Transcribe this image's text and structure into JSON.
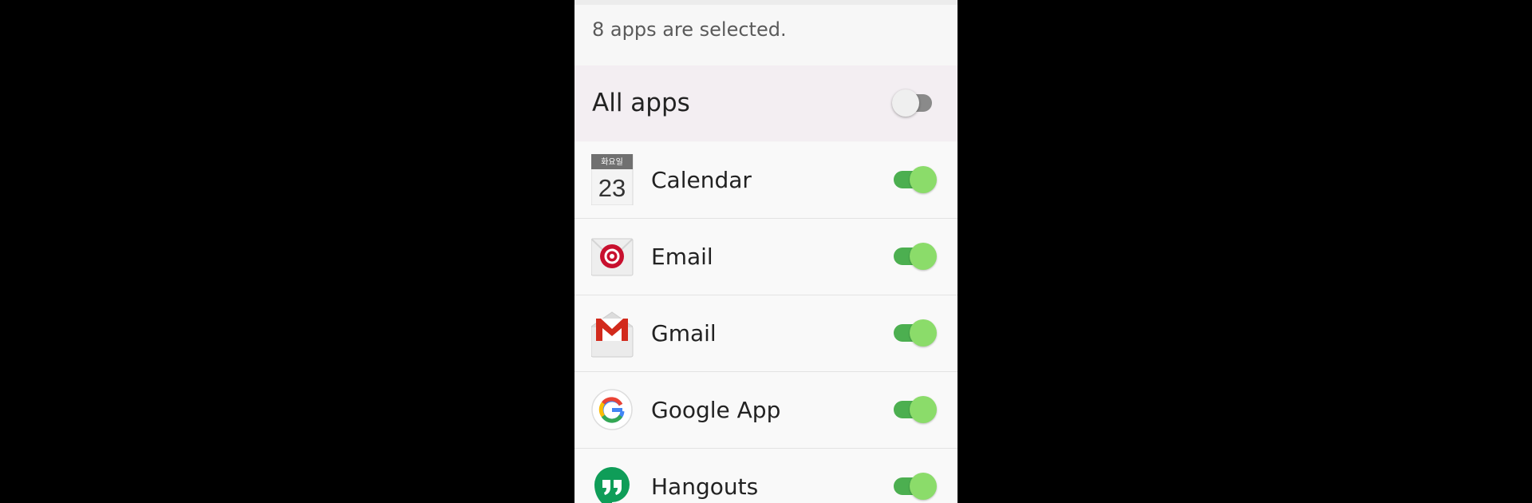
{
  "header": {
    "selected_text": "8 apps are selected."
  },
  "all_apps": {
    "label": "All apps",
    "enabled": false
  },
  "calendar_icon": {
    "weekday": "화요일",
    "day": "23"
  },
  "apps": [
    {
      "label": "Calendar",
      "icon": "calendar-icon",
      "enabled": true
    },
    {
      "label": "Email",
      "icon": "email-icon",
      "enabled": true
    },
    {
      "label": "Gmail",
      "icon": "gmail-icon",
      "enabled": true
    },
    {
      "label": "Google App",
      "icon": "google-icon",
      "enabled": true
    },
    {
      "label": "Hangouts",
      "icon": "hangouts-icon",
      "enabled": true
    }
  ],
  "colors": {
    "toggle_on_track": "#4caf50",
    "toggle_on_thumb": "#8bdc6a",
    "toggle_off_track": "#8a8a8a",
    "email_red": "#c8102e",
    "hangouts_green": "#0f9d58"
  }
}
